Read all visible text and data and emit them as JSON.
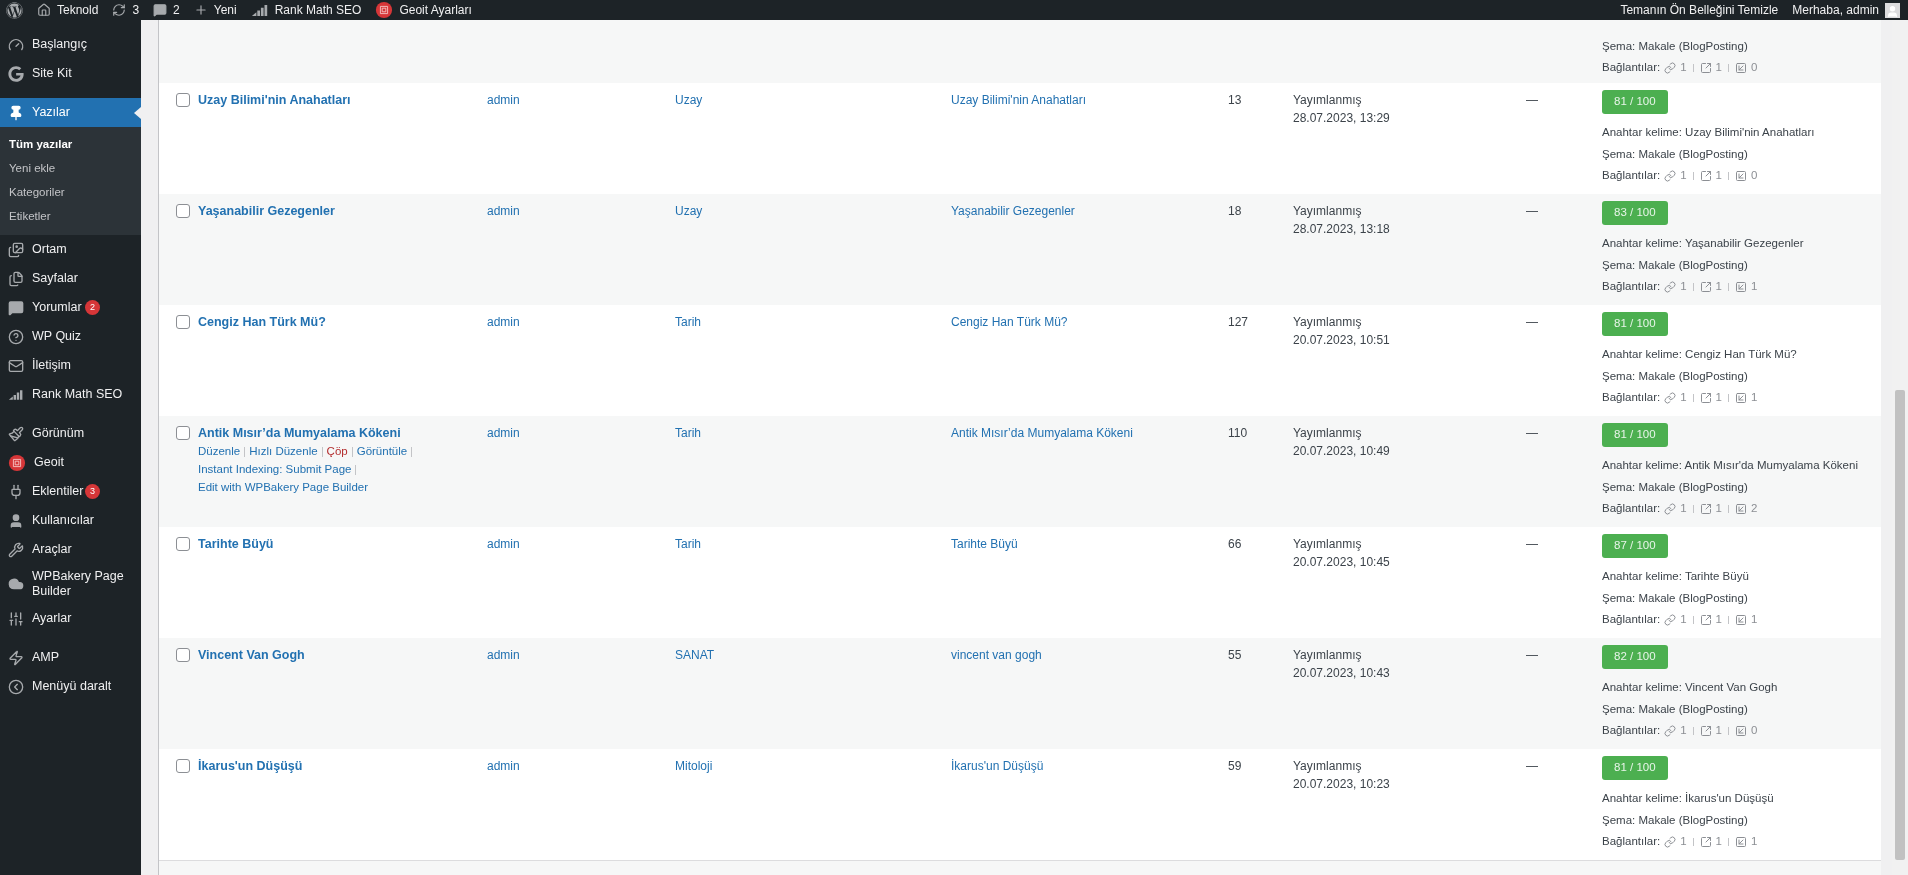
{
  "admin_bar": {
    "left": [
      {
        "kind": "wp-logo"
      },
      {
        "kind": "home",
        "label": "Teknold"
      },
      {
        "kind": "updates",
        "label": "3"
      },
      {
        "kind": "comments",
        "label": "2"
      },
      {
        "kind": "new",
        "label": "Yeni"
      },
      {
        "kind": "rankmath",
        "label": "Rank Math SEO"
      },
      {
        "kind": "geoit",
        "label": "Geoit Ayarları"
      }
    ],
    "right": [
      {
        "kind": "text",
        "label": "Temanın Ön Belleğini Temizle"
      },
      {
        "kind": "account",
        "label": "Merhaba, admin"
      }
    ]
  },
  "sidebar": {
    "groups": [
      [
        {
          "kind": "dashboard",
          "label": "Başlangıç",
          "selected": false
        },
        {
          "kind": "google",
          "label": "Site Kit",
          "selected": false
        }
      ],
      [
        {
          "kind": "pin",
          "label": "Yazılar",
          "selected": true,
          "children": [
            {
              "label": "Tüm yazılar",
              "selected": true
            },
            {
              "label": "Yeni ekle",
              "selected": false
            },
            {
              "label": "Kategoriler",
              "selected": false
            },
            {
              "label": "Etiketler",
              "selected": false
            }
          ]
        },
        {
          "kind": "media",
          "label": "Ortam",
          "selected": false
        },
        {
          "kind": "pages",
          "label": "Sayfalar",
          "selected": false
        },
        {
          "kind": "comments",
          "label": "Yorumlar",
          "selected": false,
          "badge": "2"
        },
        {
          "kind": "quiz",
          "label": "WP Quiz",
          "selected": false
        },
        {
          "kind": "mail",
          "label": "İletişim",
          "selected": false
        },
        {
          "kind": "rankmath",
          "label": "Rank Math SEO",
          "selected": false
        }
      ],
      [
        {
          "kind": "brush",
          "label": "Görünüm",
          "selected": false
        },
        {
          "kind": "geoit",
          "label": "Geoit",
          "selected": false
        },
        {
          "kind": "plug",
          "label": "Eklentiler",
          "selected": false,
          "badge": "3"
        },
        {
          "kind": "user",
          "label": "Kullanıcılar",
          "selected": false
        },
        {
          "kind": "wrench",
          "label": "Araçlar",
          "selected": false
        },
        {
          "kind": "cloud",
          "label": "WPBakery Page Builder",
          "selected": false
        },
        {
          "kind": "sliders",
          "label": "Ayarlar",
          "selected": false
        }
      ],
      [
        {
          "kind": "bolt",
          "label": "AMP",
          "selected": false
        },
        {
          "kind": "collapse",
          "label": "Menüyü daralt",
          "selected": false
        }
      ]
    ]
  },
  "top_partial_row": {
    "seo_schema": "Şema: Makale (BlogPosting)",
    "links_label": "Bağlantılar:",
    "links": {
      "internal": "1",
      "external": "1",
      "incoming": "0"
    }
  },
  "rows": [
    {
      "checked": false,
      "title": "Uzay Bilimi'nin Anahatları",
      "author": "admin",
      "category": "Uzay",
      "keyword_link": "Uzay Bilimi'nin Anahatları",
      "count": "13",
      "status": "Yayımlanmış",
      "date": "28.07.2023, 13:29",
      "dash": "—",
      "seo_score": "81 / 100",
      "seo_keyword": "Anahtar kelime: Uzay Bilimi'nin Anahatları",
      "seo_schema": "Şema: Makale (BlogPosting)",
      "links_label": "Bağlantılar:",
      "links": {
        "internal": "1",
        "external": "1",
        "incoming": "0"
      }
    },
    {
      "checked": false,
      "title": "Yaşanabilir Gezegenler",
      "author": "admin",
      "category": "Uzay",
      "keyword_link": "Yaşanabilir Gezegenler",
      "count": "18",
      "status": "Yayımlanmış",
      "date": "28.07.2023, 13:18",
      "dash": "—",
      "seo_score": "83 / 100",
      "seo_keyword": "Anahtar kelime: Yaşanabilir Gezegenler",
      "seo_schema": "Şema: Makale (BlogPosting)",
      "links_label": "Bağlantılar:",
      "links": {
        "internal": "1",
        "external": "1",
        "incoming": "1"
      }
    },
    {
      "checked": false,
      "title": "Cengiz Han Türk Mü?",
      "author": "admin",
      "category": "Tarih",
      "keyword_link": "Cengiz Han Türk Mü?",
      "count": "127",
      "status": "Yayımlanmış",
      "date": "20.07.2023, 10:51",
      "dash": "—",
      "seo_score": "81 / 100",
      "seo_keyword": "Anahtar kelime: Cengiz Han Türk Mü?",
      "seo_schema": "Şema: Makale (BlogPosting)",
      "links_label": "Bağlantılar:",
      "links": {
        "internal": "1",
        "external": "1",
        "incoming": "1"
      }
    },
    {
      "checked": false,
      "title": "Antik Mısır’da Mumyalama Kökeni",
      "actions": [
        {
          "label": "Düzenle",
          "kind": "normal"
        },
        {
          "label": "Hızlı Düzenle",
          "kind": "normal"
        },
        {
          "label": "Çöp",
          "kind": "danger"
        },
        {
          "label": "Görüntüle",
          "kind": "normal"
        },
        {
          "label": "Instant Indexing: Submit Page",
          "kind": "normal"
        },
        {
          "label": "Edit with WPBakery Page Builder",
          "kind": "normal"
        }
      ],
      "author": "admin",
      "category": "Tarih",
      "keyword_link": "Antik Mısır’da Mumyalama Kökeni",
      "count": "110",
      "status": "Yayımlanmış",
      "date": "20.07.2023, 10:49",
      "dash": "—",
      "seo_score": "81 / 100",
      "seo_keyword": "Anahtar kelime: Antik Mısır'da Mumyalama Kökeni",
      "seo_schema": "Şema: Makale (BlogPosting)",
      "links_label": "Bağlantılar:",
      "links": {
        "internal": "1",
        "external": "1",
        "incoming": "2"
      }
    },
    {
      "checked": false,
      "title": "Tarihte Büyü",
      "author": "admin",
      "category": "Tarih",
      "keyword_link": "Tarihte Büyü",
      "count": "66",
      "status": "Yayımlanmış",
      "date": "20.07.2023, 10:45",
      "dash": "—",
      "seo_score": "87 / 100",
      "seo_keyword": "Anahtar kelime: Tarihte Büyü",
      "seo_schema": "Şema: Makale (BlogPosting)",
      "links_label": "Bağlantılar:",
      "links": {
        "internal": "1",
        "external": "1",
        "incoming": "1"
      }
    },
    {
      "checked": false,
      "title": "Vincent Van Gogh",
      "author": "admin",
      "category": "SANAT",
      "keyword_link": "vincent van gogh",
      "count": "55",
      "status": "Yayımlanmış",
      "date": "20.07.2023, 10:43",
      "dash": "—",
      "seo_score": "82 / 100",
      "seo_keyword": "Anahtar kelime: Vincent Van Gogh",
      "seo_schema": "Şema: Makale (BlogPosting)",
      "links_label": "Bağlantılar:",
      "links": {
        "internal": "1",
        "external": "1",
        "incoming": "0"
      }
    },
    {
      "checked": false,
      "title": "İkarus'un Düşüşü",
      "author": "admin",
      "category": "Mitoloji",
      "keyword_link": "İkarus'un Düşüşü",
      "count": "59",
      "status": "Yayımlanmış",
      "date": "20.07.2023, 10:23",
      "dash": "—",
      "seo_score": "81 / 100",
      "seo_keyword": "Anahtar kelime: İkarus'un Düşüşü",
      "seo_schema": "Şema: Makale (BlogPosting)",
      "links_label": "Bağlantılar:",
      "links": {
        "internal": "1",
        "external": "1",
        "incoming": "1"
      }
    }
  ]
}
